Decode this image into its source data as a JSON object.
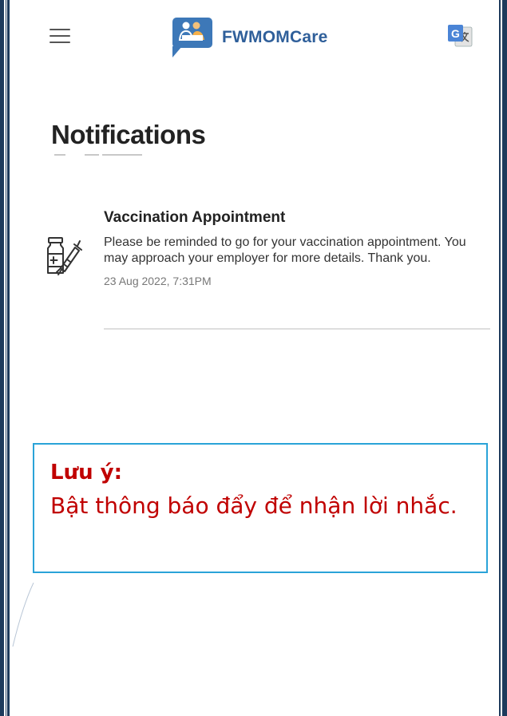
{
  "header": {
    "brand": "FWMOMCare",
    "menu_icon": "hamburger-menu-icon",
    "logo_icon": "fwmomcare-logo-icon",
    "translate_icon": "google-translate-icon",
    "brand_color": "#2f5f9a"
  },
  "page": {
    "title": "Notifications"
  },
  "notifications": [
    {
      "icon": "vaccine-syringe-icon",
      "title": "Vaccination Appointment",
      "text": "Please be reminded to go for your vaccination appointment. You may approach your employer for more details. Thank you.",
      "time": "23 Aug 2022, 7:31PM"
    }
  ],
  "note": {
    "label": "Lưu ý:",
    "text": "Bật thông báo đẩy để nhận lời nhắc.",
    "color": "#c00000",
    "border_color": "#2aa3d8"
  }
}
